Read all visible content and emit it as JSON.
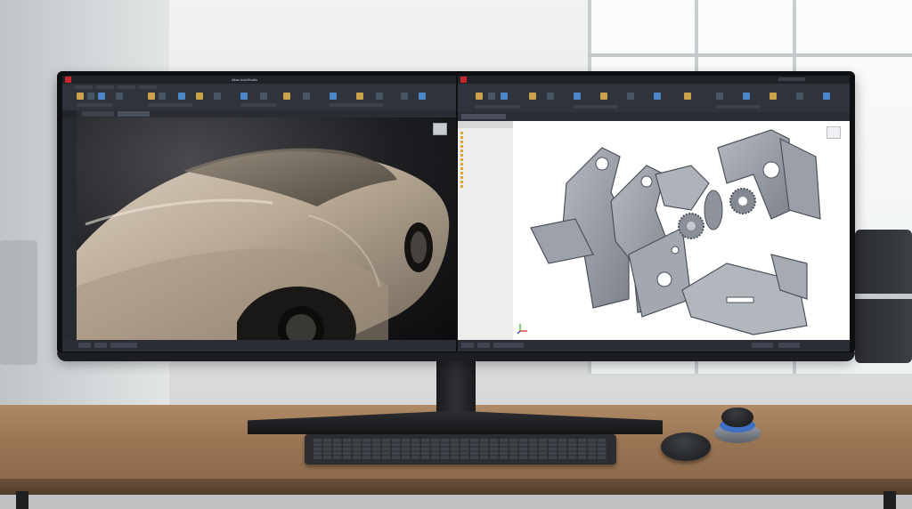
{
  "scene": {
    "description": "Curved ultrawide monitor on a wooden desk showing two CAD applications side by side",
    "colors": {
      "wall": "#e6e8e8",
      "desk": "#9a7554",
      "bezel": "#0e0f11",
      "cad_ui_dark": "#2f333b",
      "viewport_white": "#ffffff",
      "part_gray": "#8d929c"
    }
  },
  "left_app": {
    "window_title": "Alias AutoStudio",
    "viewport_subject": "car-surface-render",
    "icons": [
      "app-logo-icon",
      "viewcube-icon"
    ]
  },
  "right_app": {
    "viewport_subject": "sheet-metal-bracket-assembly",
    "icons": [
      "app-logo-icon",
      "viewcube-icon",
      "triad-axis-icon"
    ]
  },
  "peripherals": [
    "keyboard",
    "mouse",
    "3d-spacemouse"
  ]
}
